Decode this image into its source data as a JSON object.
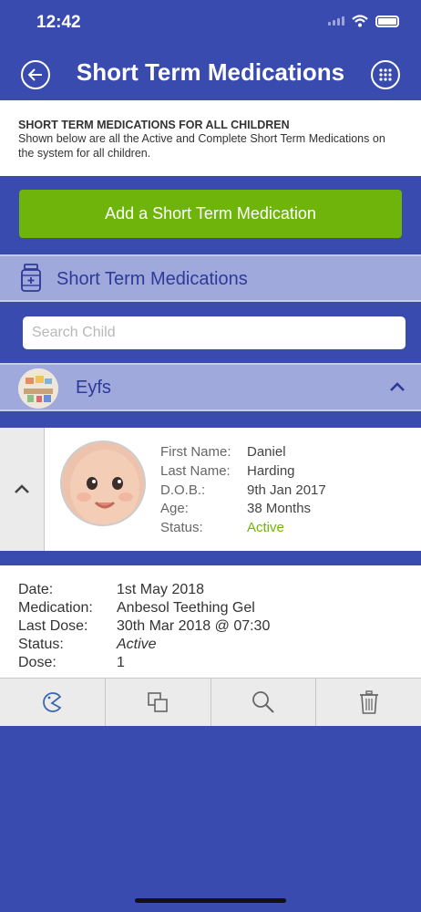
{
  "status_bar": {
    "time": "12:42"
  },
  "nav": {
    "title": "Short Term Medications",
    "back_icon": "back-arrow-icon",
    "menu_icon": "grid-menu-icon"
  },
  "info": {
    "heading": "SHORT TERM MEDICATIONS FOR ALL CHILDREN",
    "text": "Shown below are all the Active and Complete Short Term Medications on the system for all children."
  },
  "add_button": {
    "label": "Add a Short Term Medication"
  },
  "section": {
    "title": "Short Term Medications",
    "icon": "medicine-bottle-icon"
  },
  "search": {
    "placeholder": "Search Child",
    "value": ""
  },
  "group": {
    "title": "Eyfs"
  },
  "child": {
    "fields": [
      {
        "label": "First Name:",
        "value": "Daniel"
      },
      {
        "label": "Last Name:",
        "value": "Harding"
      },
      {
        "label": "D.O.B.:",
        "value": "9th Jan 2017"
      },
      {
        "label": "Age:",
        "value": "38 Months"
      },
      {
        "label": "Status:",
        "value": "Active"
      }
    ]
  },
  "medication": {
    "fields": [
      {
        "label": "Date:",
        "value": "1st May 2018"
      },
      {
        "label": "Medication:",
        "value": "Anbesol Teething Gel"
      },
      {
        "label": "Last Dose:",
        "value": "30th Mar 2018 @ 07:30"
      },
      {
        "label": "Status:",
        "value": "Active"
      },
      {
        "label": "Dose:",
        "value": "1"
      }
    ]
  },
  "actions": [
    "pacman-icon",
    "copy-icon",
    "search-icon",
    "trash-icon"
  ],
  "colors": {
    "background": "#3a4baf",
    "accent_green": "#6fb40a",
    "header_band": "#9fa9dc",
    "header_text": "#2f3a98"
  }
}
